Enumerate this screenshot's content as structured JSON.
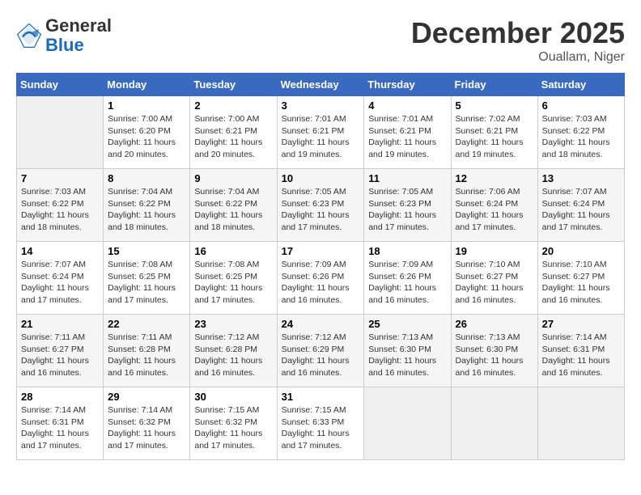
{
  "header": {
    "logo_general": "General",
    "logo_blue": "Blue",
    "month": "December 2025",
    "location": "Ouallam, Niger"
  },
  "days_of_week": [
    "Sunday",
    "Monday",
    "Tuesday",
    "Wednesday",
    "Thursday",
    "Friday",
    "Saturday"
  ],
  "weeks": [
    [
      {
        "num": "",
        "sunrise": "",
        "sunset": "",
        "daylight": "",
        "empty": true
      },
      {
        "num": "1",
        "sunrise": "Sunrise: 7:00 AM",
        "sunset": "Sunset: 6:20 PM",
        "daylight": "Daylight: 11 hours and 20 minutes."
      },
      {
        "num": "2",
        "sunrise": "Sunrise: 7:00 AM",
        "sunset": "Sunset: 6:21 PM",
        "daylight": "Daylight: 11 hours and 20 minutes."
      },
      {
        "num": "3",
        "sunrise": "Sunrise: 7:01 AM",
        "sunset": "Sunset: 6:21 PM",
        "daylight": "Daylight: 11 hours and 19 minutes."
      },
      {
        "num": "4",
        "sunrise": "Sunrise: 7:01 AM",
        "sunset": "Sunset: 6:21 PM",
        "daylight": "Daylight: 11 hours and 19 minutes."
      },
      {
        "num": "5",
        "sunrise": "Sunrise: 7:02 AM",
        "sunset": "Sunset: 6:21 PM",
        "daylight": "Daylight: 11 hours and 19 minutes."
      },
      {
        "num": "6",
        "sunrise": "Sunrise: 7:03 AM",
        "sunset": "Sunset: 6:22 PM",
        "daylight": "Daylight: 11 hours and 18 minutes."
      }
    ],
    [
      {
        "num": "7",
        "sunrise": "Sunrise: 7:03 AM",
        "sunset": "Sunset: 6:22 PM",
        "daylight": "Daylight: 11 hours and 18 minutes."
      },
      {
        "num": "8",
        "sunrise": "Sunrise: 7:04 AM",
        "sunset": "Sunset: 6:22 PM",
        "daylight": "Daylight: 11 hours and 18 minutes."
      },
      {
        "num": "9",
        "sunrise": "Sunrise: 7:04 AM",
        "sunset": "Sunset: 6:22 PM",
        "daylight": "Daylight: 11 hours and 18 minutes."
      },
      {
        "num": "10",
        "sunrise": "Sunrise: 7:05 AM",
        "sunset": "Sunset: 6:23 PM",
        "daylight": "Daylight: 11 hours and 17 minutes."
      },
      {
        "num": "11",
        "sunrise": "Sunrise: 7:05 AM",
        "sunset": "Sunset: 6:23 PM",
        "daylight": "Daylight: 11 hours and 17 minutes."
      },
      {
        "num": "12",
        "sunrise": "Sunrise: 7:06 AM",
        "sunset": "Sunset: 6:24 PM",
        "daylight": "Daylight: 11 hours and 17 minutes."
      },
      {
        "num": "13",
        "sunrise": "Sunrise: 7:07 AM",
        "sunset": "Sunset: 6:24 PM",
        "daylight": "Daylight: 11 hours and 17 minutes."
      }
    ],
    [
      {
        "num": "14",
        "sunrise": "Sunrise: 7:07 AM",
        "sunset": "Sunset: 6:24 PM",
        "daylight": "Daylight: 11 hours and 17 minutes."
      },
      {
        "num": "15",
        "sunrise": "Sunrise: 7:08 AM",
        "sunset": "Sunset: 6:25 PM",
        "daylight": "Daylight: 11 hours and 17 minutes."
      },
      {
        "num": "16",
        "sunrise": "Sunrise: 7:08 AM",
        "sunset": "Sunset: 6:25 PM",
        "daylight": "Daylight: 11 hours and 17 minutes."
      },
      {
        "num": "17",
        "sunrise": "Sunrise: 7:09 AM",
        "sunset": "Sunset: 6:26 PM",
        "daylight": "Daylight: 11 hours and 16 minutes."
      },
      {
        "num": "18",
        "sunrise": "Sunrise: 7:09 AM",
        "sunset": "Sunset: 6:26 PM",
        "daylight": "Daylight: 11 hours and 16 minutes."
      },
      {
        "num": "19",
        "sunrise": "Sunrise: 7:10 AM",
        "sunset": "Sunset: 6:27 PM",
        "daylight": "Daylight: 11 hours and 16 minutes."
      },
      {
        "num": "20",
        "sunrise": "Sunrise: 7:10 AM",
        "sunset": "Sunset: 6:27 PM",
        "daylight": "Daylight: 11 hours and 16 minutes."
      }
    ],
    [
      {
        "num": "21",
        "sunrise": "Sunrise: 7:11 AM",
        "sunset": "Sunset: 6:27 PM",
        "daylight": "Daylight: 11 hours and 16 minutes."
      },
      {
        "num": "22",
        "sunrise": "Sunrise: 7:11 AM",
        "sunset": "Sunset: 6:28 PM",
        "daylight": "Daylight: 11 hours and 16 minutes."
      },
      {
        "num": "23",
        "sunrise": "Sunrise: 7:12 AM",
        "sunset": "Sunset: 6:28 PM",
        "daylight": "Daylight: 11 hours and 16 minutes."
      },
      {
        "num": "24",
        "sunrise": "Sunrise: 7:12 AM",
        "sunset": "Sunset: 6:29 PM",
        "daylight": "Daylight: 11 hours and 16 minutes."
      },
      {
        "num": "25",
        "sunrise": "Sunrise: 7:13 AM",
        "sunset": "Sunset: 6:30 PM",
        "daylight": "Daylight: 11 hours and 16 minutes."
      },
      {
        "num": "26",
        "sunrise": "Sunrise: 7:13 AM",
        "sunset": "Sunset: 6:30 PM",
        "daylight": "Daylight: 11 hours and 16 minutes."
      },
      {
        "num": "27",
        "sunrise": "Sunrise: 7:14 AM",
        "sunset": "Sunset: 6:31 PM",
        "daylight": "Daylight: 11 hours and 16 minutes."
      }
    ],
    [
      {
        "num": "28",
        "sunrise": "Sunrise: 7:14 AM",
        "sunset": "Sunset: 6:31 PM",
        "daylight": "Daylight: 11 hours and 17 minutes."
      },
      {
        "num": "29",
        "sunrise": "Sunrise: 7:14 AM",
        "sunset": "Sunset: 6:32 PM",
        "daylight": "Daylight: 11 hours and 17 minutes."
      },
      {
        "num": "30",
        "sunrise": "Sunrise: 7:15 AM",
        "sunset": "Sunset: 6:32 PM",
        "daylight": "Daylight: 11 hours and 17 minutes."
      },
      {
        "num": "31",
        "sunrise": "Sunrise: 7:15 AM",
        "sunset": "Sunset: 6:33 PM",
        "daylight": "Daylight: 11 hours and 17 minutes."
      },
      {
        "num": "",
        "sunrise": "",
        "sunset": "",
        "daylight": "",
        "empty": true
      },
      {
        "num": "",
        "sunrise": "",
        "sunset": "",
        "daylight": "",
        "empty": true
      },
      {
        "num": "",
        "sunrise": "",
        "sunset": "",
        "daylight": "",
        "empty": true
      }
    ]
  ]
}
